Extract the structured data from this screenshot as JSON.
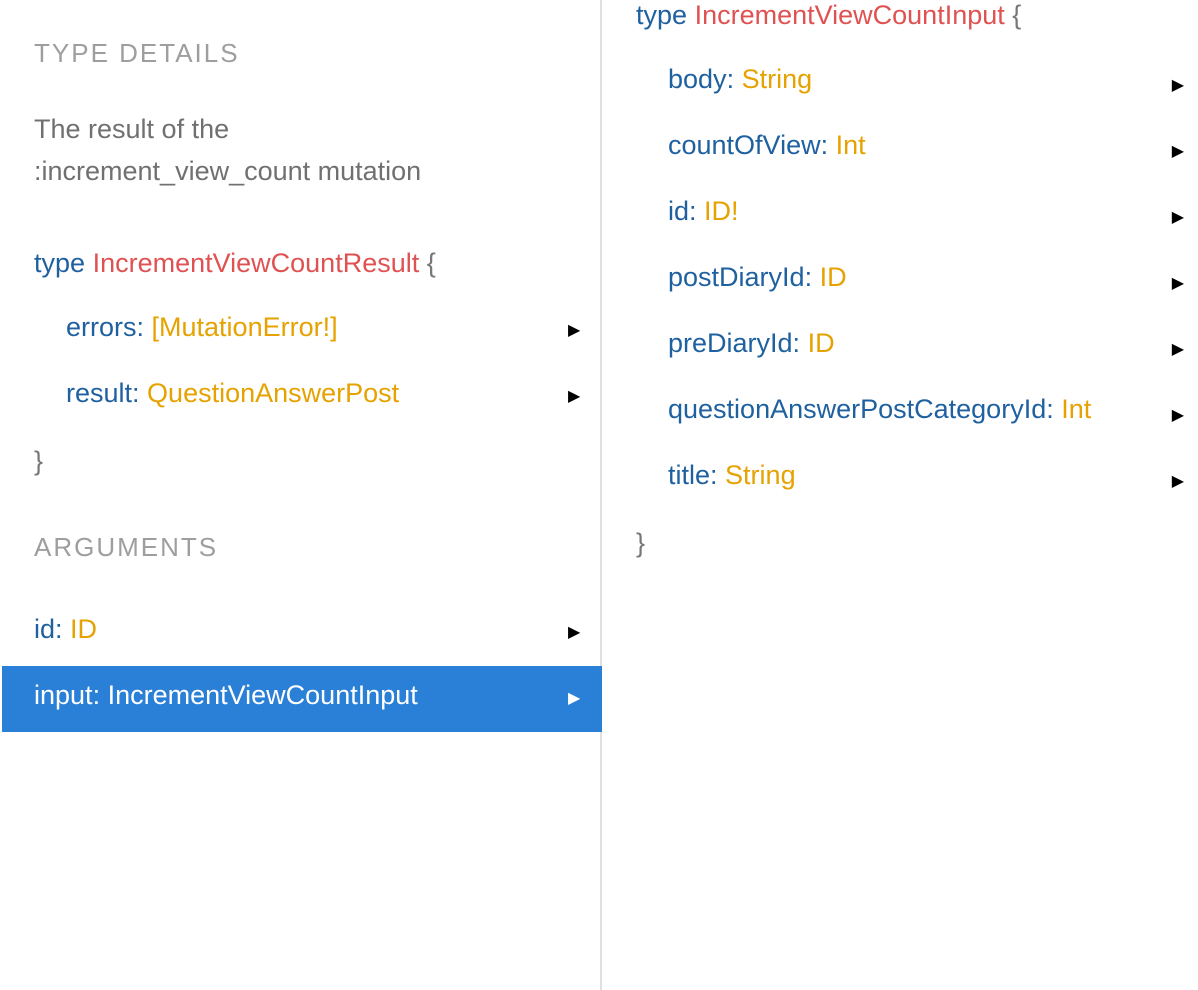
{
  "left": {
    "type_details_label": "TYPE DETAILS",
    "description_line1": "The result of the",
    "description_line2": ":increment_view_count mutation",
    "type_keyword": "type",
    "type_name": "IncrementViewCountResult",
    "open_brace": "{",
    "close_brace": "}",
    "fields": [
      {
        "name": "errors",
        "type": "[MutationError!]"
      },
      {
        "name": "result",
        "type": "QuestionAnswerPost"
      }
    ],
    "arguments_label": "ARGUMENTS",
    "arguments": [
      {
        "name": "id",
        "type": "ID"
      },
      {
        "name": "input",
        "type": "IncrementViewCountInput"
      }
    ]
  },
  "right": {
    "type_keyword": "type",
    "type_name": "IncrementViewCountInput",
    "open_brace": "{",
    "close_brace": "}",
    "fields": [
      {
        "name": "body",
        "type": "String"
      },
      {
        "name": "countOfView",
        "type": "Int"
      },
      {
        "name": "id",
        "type": "ID!"
      },
      {
        "name": "postDiaryId",
        "type": "ID"
      },
      {
        "name": "preDiaryId",
        "type": "ID"
      },
      {
        "name": "questionAnswerPostCategoryId",
        "type": "Int"
      },
      {
        "name": "title",
        "type": "String"
      }
    ]
  },
  "colors": {
    "selected_row_bg": "#2a7fd6",
    "keyword": "#1f61a0",
    "type_name": "#e05252",
    "field_type": "#e6a200",
    "section_label": "#9e9e9e"
  },
  "icons": {
    "expand": "triangle-right-icon"
  },
  "arrow_glyph": "▶"
}
